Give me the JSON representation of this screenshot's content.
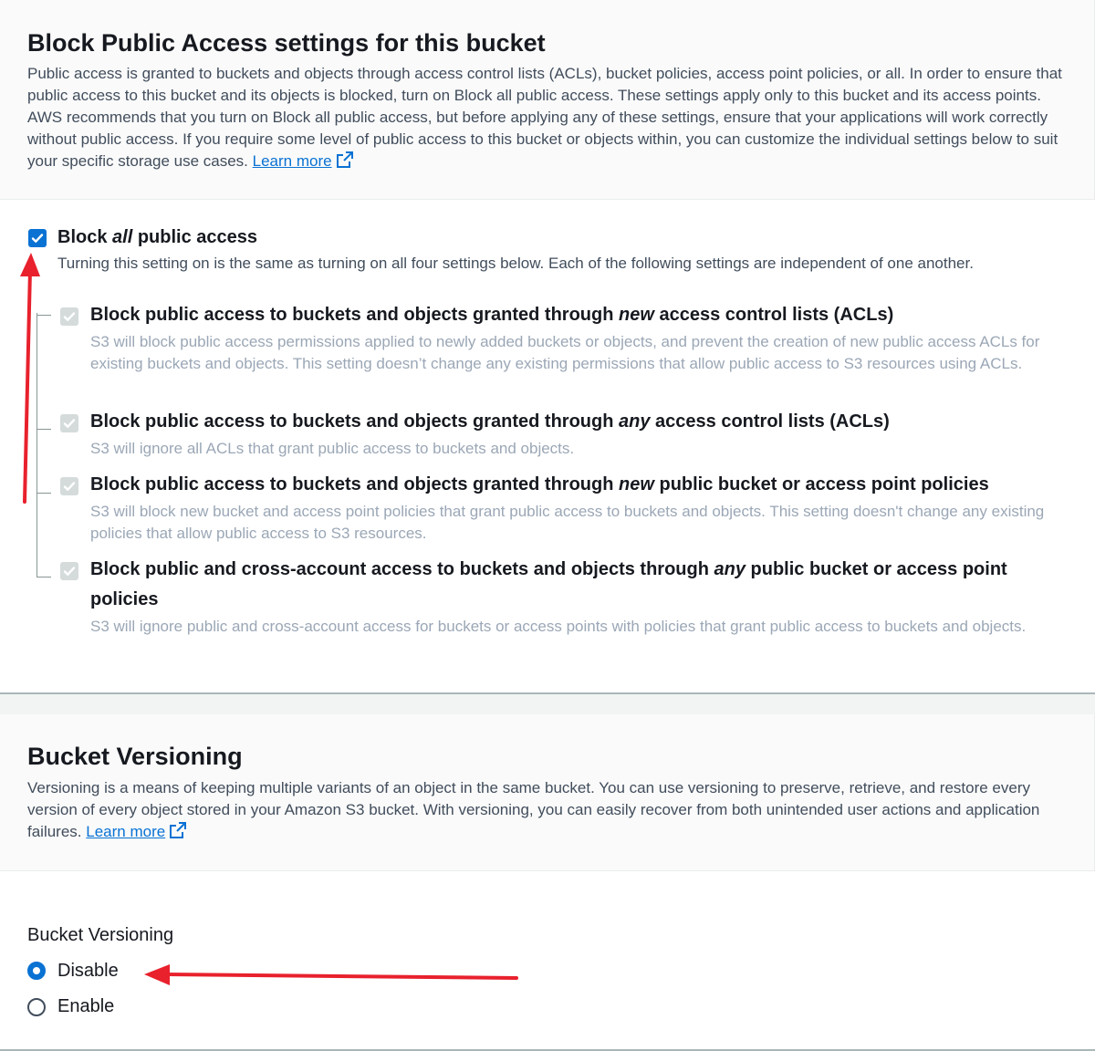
{
  "block_public_access": {
    "title": "Block Public Access settings for this bucket",
    "description": "Public access is granted to buckets and objects through access control lists (ACLs), bucket policies, access point policies, or all. In order to ensure that public access to this bucket and its objects is blocked, turn on Block all public access. These settings apply only to this bucket and its access points. AWS recommends that you turn on Block all public access, but before applying any of these settings, ensure that your applications will work correctly without public access. If you require some level of public access to this bucket or objects within, you can customize the individual settings below to suit your specific storage use cases.",
    "learn_more": "Learn more",
    "block_all": {
      "label_pre": "Block ",
      "label_em": "all",
      "label_post": " public access",
      "description": "Turning this setting on is the same as turning on all four settings below. Each of the following settings are independent of one another.",
      "checked": true
    },
    "options": [
      {
        "label_pre": "Block public access to buckets and objects granted through ",
        "label_em": "new",
        "label_post": " access control lists (ACLs)",
        "description": "S3 will block public access permissions applied to newly added buckets or objects, and prevent the creation of new public access ACLs for existing buckets and objects. This setting doesn’t change any existing permissions that allow public access to S3 resources using ACLs.",
        "checked": true,
        "disabled": true
      },
      {
        "label_pre": "Block public access to buckets and objects granted through ",
        "label_em": "any",
        "label_post": " access control lists (ACLs)",
        "description": "S3 will ignore all ACLs that grant public access to buckets and objects.",
        "checked": true,
        "disabled": true
      },
      {
        "label_pre": "Block public access to buckets and objects granted through ",
        "label_em": "new",
        "label_post": " public bucket or access point policies",
        "description": "S3 will block new bucket and access point policies that grant public access to buckets and objects. This setting doesn't change any existing policies that allow public access to S3 resources.",
        "checked": true,
        "disabled": true
      },
      {
        "label_pre": "Block public and cross-account access to buckets and objects through ",
        "label_em": "any",
        "label_post": " public bucket or access point policies",
        "description": "S3 will ignore public and cross-account access for buckets or access points with policies that grant public access to buckets and objects.",
        "checked": true,
        "disabled": true
      }
    ]
  },
  "bucket_versioning": {
    "title": "Bucket Versioning",
    "description": "Versioning is a means of keeping multiple variants of an object in the same bucket. You can use versioning to preserve, retrieve, and restore every version of every object stored in your Amazon S3 bucket. With versioning, you can easily recover from both unintended user actions and application failures.",
    "learn_more": "Learn more",
    "field_label": "Bucket Versioning",
    "options": [
      {
        "label": "Disable",
        "selected": true
      },
      {
        "label": "Enable",
        "selected": false
      }
    ]
  },
  "colors": {
    "accent": "#0972d3",
    "annotation_arrow": "#e8212d",
    "disabled_text": "#9ba7b6"
  }
}
